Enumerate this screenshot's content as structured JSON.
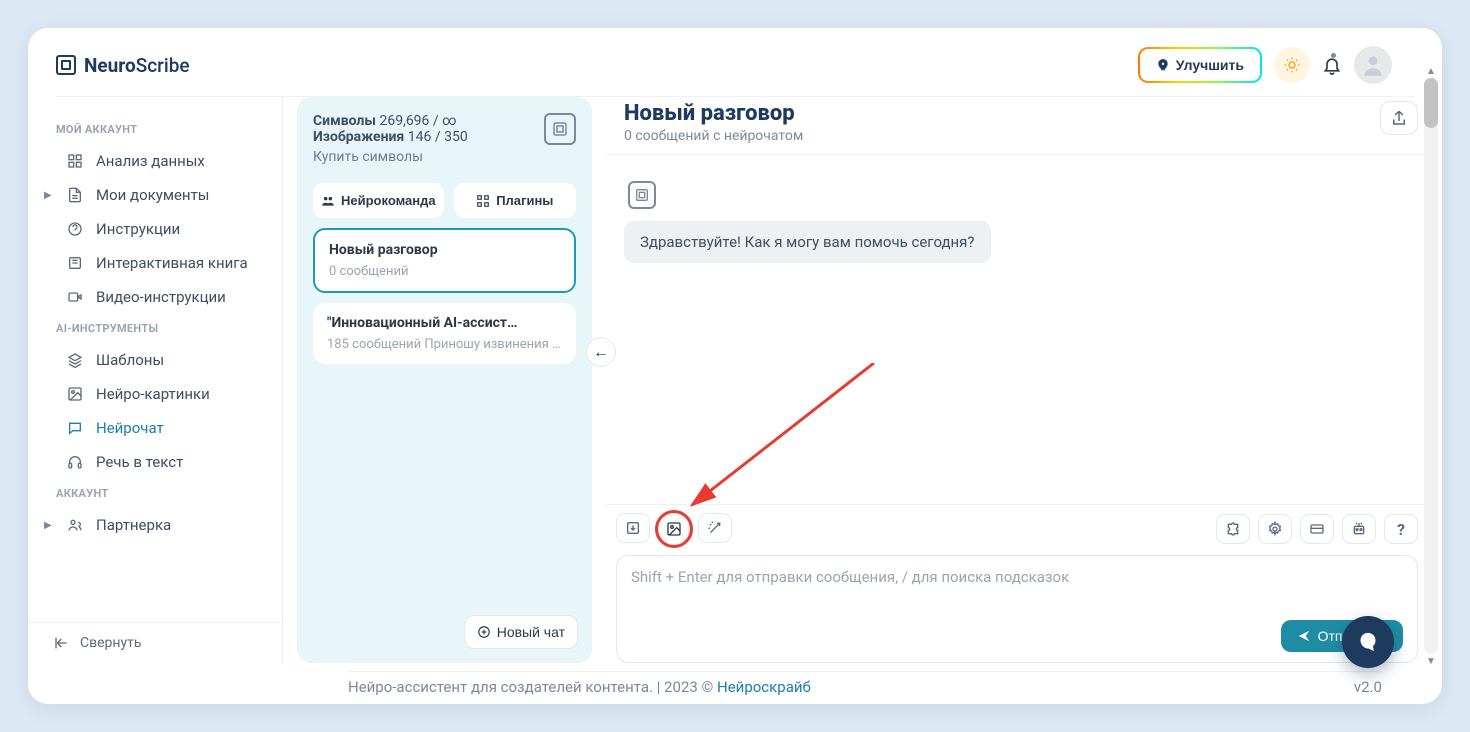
{
  "brand": {
    "strong": "Neuro",
    "light": "Scribe"
  },
  "header": {
    "upgrade": "Улучшить"
  },
  "sidebar": {
    "sections": {
      "account_title": "МОЙ АККАУНТ",
      "ai_tools_title": "AI-ИНСТРУМЕНТЫ",
      "account2_title": "АККАУНТ"
    },
    "items": {
      "analytics": "Анализ данных",
      "documents": "Мои документы",
      "instructions": "Инструкции",
      "interactive_book": "Интерактивная книга",
      "video_instructions": "Видео-инструкции",
      "templates": "Шаблоны",
      "neuro_images": "Нейро-картинки",
      "neurochat": "Нейрочат",
      "speech_to_text": "Речь в текст",
      "partner": "Партнерка"
    },
    "collapse": "Свернуть"
  },
  "stats": {
    "symbols_label": "Символы",
    "symbols_value": "269,696 / ∞",
    "images_label": "Изображения",
    "images_value": "146 / 350",
    "buy": "Купить символы"
  },
  "tabs": {
    "neuroteam": "Нейрокоманда",
    "plugins": "Плагины"
  },
  "conversations": [
    {
      "title": "Новый разговор",
      "sub": "0 сообщений",
      "active": true
    },
    {
      "title": "\"Инновационный AI-ассист…",
      "sub": "185 сообщений Приношу извинения …",
      "active": false
    }
  ],
  "new_chat": "Новый чат",
  "chat": {
    "title": "Новый разговор",
    "sub": "0 сообщений с нейрочатом",
    "greeting": "Здравствуйте! Как я могу вам помочь сегодня?"
  },
  "composer": {
    "placeholder": "Shift + Enter для отправки сообщения, / для поиска подсказок",
    "send": "Отправить"
  },
  "toolbar": {
    "help": "?"
  },
  "footer": {
    "text": "Нейро-ассистент для создателей контента.  |  2023 © ",
    "brand": "Нейроскрайб",
    "version": "v2.0"
  }
}
